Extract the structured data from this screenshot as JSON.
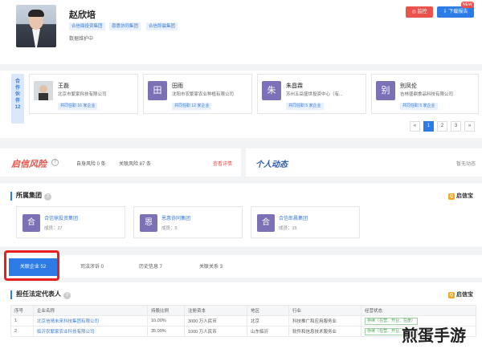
{
  "header": {
    "name": "赵欣培",
    "tags": [
      "合信鼎投资集团",
      "恩惠协同集团",
      "合信郎晨集团"
    ],
    "maintenance": "数据维护中",
    "monitor_label": "监控",
    "report_label": "下载报告",
    "new_badge": "NEW"
  },
  "partners": {
    "label": "合作伙伴12",
    "cards": [
      {
        "avatar": "",
        "name": "王磊",
        "company": "北京市繁家科技有限公司",
        "tag": "共同任职 16 家企业",
        "color": "#666"
      },
      {
        "avatar": "田",
        "name": "田雨",
        "company": "沈阳市农繁家农业种植有限公司",
        "tag": "共同任职 12 家企业",
        "color": "#7c71b7"
      },
      {
        "avatar": "朱",
        "name": "朱昌霖",
        "company": "苏州五岳盛世投资中心（有...",
        "tag": "共同任职 5 家企业",
        "color": "#7c71b7"
      },
      {
        "avatar": "别",
        "name": "别凤伦",
        "company": "吉林盛鼎食品科技有限公司",
        "tag": "共同任职 5 家企业",
        "color": "#7c71b7"
      }
    ],
    "pagination": [
      "«",
      "1",
      "2",
      "3",
      "»"
    ]
  },
  "risk": {
    "title": "启信风险",
    "self": "自身风险 0 条",
    "assoc": "关联风险 87 条",
    "more": "查看详情"
  },
  "dynamic": {
    "title": "个人动态",
    "more": "暂无动态"
  },
  "group": {
    "title": "所属集团",
    "count": "3",
    "brand": "启信宝",
    "items": [
      {
        "avatar": "合",
        "name": "合信鼎投资集团",
        "members": "成员：27"
      },
      {
        "avatar": "恩",
        "name": "恩惠协同集团",
        "members": "成员：5"
      },
      {
        "avatar": "合",
        "name": "合信郎晨集团",
        "members": "成员：15"
      }
    ]
  },
  "tabs": [
    "关联企业 52",
    "司法涉诉 0",
    "历史信息 7",
    "关联关系 3"
  ],
  "legal": {
    "title": "担任法定代表人",
    "count": "2",
    "brand": "启信宝",
    "columns": [
      "序号",
      "企业名称",
      "持股比例",
      "注册资本",
      "地区",
      "行业",
      "经营状态"
    ],
    "rows": [
      [
        "1",
        "北京信晴未来科技集团有限公司",
        "10.00%",
        "3000 万人民币",
        "北京",
        "科技推广和应用服务业",
        "存续（在营、开业、在册）"
      ],
      [
        "2",
        "临沂农繁家农业科技有限公司",
        "35.00%",
        "1000 万人民币",
        "山东临沂",
        "软件和信息技术服务业",
        "存续（在营、开业、在册）"
      ]
    ]
  },
  "watermark": "煎蛋手游"
}
